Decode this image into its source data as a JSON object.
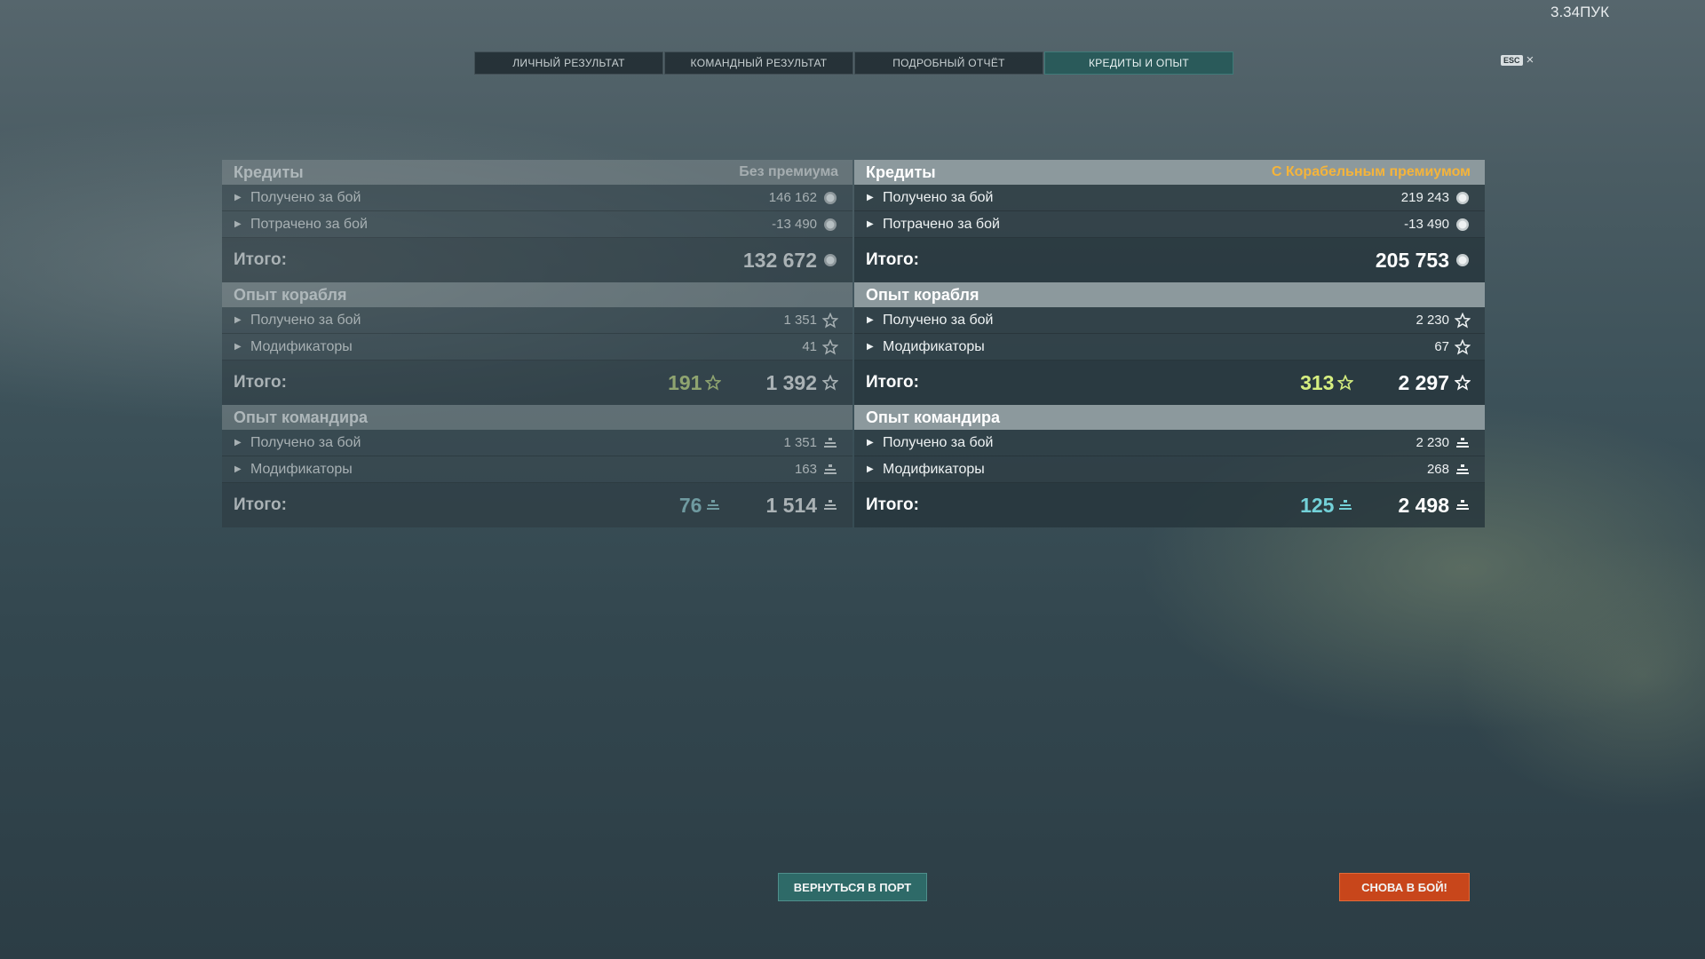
{
  "version": "3.34ПУК",
  "tabs": [
    {
      "label": "ЛИЧНЫЙ РЕЗУЛЬТАТ",
      "active": false
    },
    {
      "label": "КОМАНДНЫЙ РЕЗУЛЬТАТ",
      "active": false
    },
    {
      "label": "ПОДРОБНЫЙ ОТЧЁТ",
      "active": false
    },
    {
      "label": "КРЕДИТЫ И ОПЫТ",
      "active": true
    }
  ],
  "esc": {
    "key": "ESC",
    "close": "×"
  },
  "left": {
    "credits": {
      "title": "Кредиты",
      "subtitle": "Без премиума",
      "rows": [
        {
          "label": "Получено за бой",
          "value": "146 162"
        },
        {
          "label": "Потрачено за бой",
          "value": "-13 490"
        }
      ],
      "total_label": "Итого:",
      "total": "132 672"
    },
    "ship_xp": {
      "title": "Опыт корабля",
      "rows": [
        {
          "label": "Получено за бой",
          "value": "1 351"
        },
        {
          "label": "Модификаторы",
          "value": "41"
        }
      ],
      "total_label": "Итого:",
      "bonus": "191",
      "total": "1 392"
    },
    "commander_xp": {
      "title": "Опыт командира",
      "rows": [
        {
          "label": "Получено за бой",
          "value": "1 351"
        },
        {
          "label": "Модификаторы",
          "value": "163"
        }
      ],
      "total_label": "Итого:",
      "bonus": "76",
      "total": "1 514"
    }
  },
  "right": {
    "credits": {
      "title": "Кредиты",
      "subtitle": "С Корабельным премиумом",
      "rows": [
        {
          "label": "Получено за бой",
          "value": "219 243"
        },
        {
          "label": "Потрачено за бой",
          "value": "-13 490"
        }
      ],
      "total_label": "Итого:",
      "total": "205 753"
    },
    "ship_xp": {
      "title": "Опыт корабля",
      "rows": [
        {
          "label": "Получено за бой",
          "value": "2 230"
        },
        {
          "label": "Модификаторы",
          "value": "67"
        }
      ],
      "total_label": "Итого:",
      "bonus": "313",
      "total": "2 297"
    },
    "commander_xp": {
      "title": "Опыт командира",
      "rows": [
        {
          "label": "Получено за бой",
          "value": "2 230"
        },
        {
          "label": "Модификаторы",
          "value": "268"
        }
      ],
      "total_label": "Итого:",
      "bonus": "125",
      "total": "2 498"
    }
  },
  "icons": {
    "credits": "credits-coin-icon",
    "ship_xp": "star-icon",
    "commander_xp": "commander-xp-icon",
    "row_expand": "triangle-right-icon"
  },
  "buttons": {
    "return_port": "ВЕРНУТЬСЯ В ПОРТ",
    "battle_again": "СНОВА В БОЙ!"
  },
  "colors": {
    "premium_accent": "#f5b43a",
    "ship_bonus": "#d6ee80",
    "commander_bonus": "#73d1d8",
    "battle_button": "#c8461b",
    "port_button": "#2e6a68"
  }
}
